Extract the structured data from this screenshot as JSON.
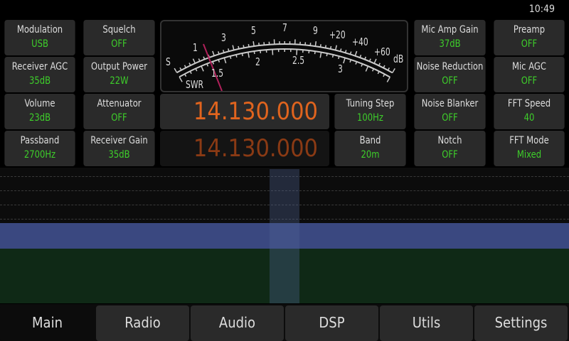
{
  "status": {
    "time": "10:49"
  },
  "controls": [
    {
      "label": "Modulation",
      "value": "USB"
    },
    {
      "label": "Squelch",
      "value": "OFF"
    },
    {
      "label": "Mic Amp Gain",
      "value": "37dB"
    },
    {
      "label": "Preamp",
      "value": "OFF"
    },
    {
      "label": "Receiver AGC",
      "value": "35dB"
    },
    {
      "label": "Output Power",
      "value": "22W"
    },
    {
      "label": "Noise Reduction",
      "value": "OFF"
    },
    {
      "label": "Mic AGC",
      "value": "OFF"
    },
    {
      "label": "Volume",
      "value": "23dB"
    },
    {
      "label": "Attenuator",
      "value": "OFF"
    },
    {
      "label": "Tuning Step",
      "value": "100Hz"
    },
    {
      "label": "Noise Blanker",
      "value": "OFF"
    },
    {
      "label": "FFT Speed",
      "value": "40"
    },
    {
      "label": "Passband",
      "value": "2700Hz"
    },
    {
      "label": "Receiver Gain",
      "value": "35dB"
    },
    {
      "label": "Band",
      "value": "20m"
    },
    {
      "label": "Notch",
      "value": "OFF"
    },
    {
      "label": "FFT Mode",
      "value": "Mixed"
    }
  ],
  "meter": {
    "s_labels": [
      "S",
      "1",
      "3",
      "5",
      "7",
      "9",
      "+20",
      "+40",
      "+60",
      "dB"
    ],
    "swr_labels": [
      "SWR",
      "1.5",
      "2",
      "2.5",
      "3"
    ],
    "needle_color": "#b0205a"
  },
  "frequency": {
    "vfo_a": "14.130.000",
    "vfo_b": "14.130.000",
    "active_color": "#e0641e",
    "inactive_color": "#8a3a14"
  },
  "tabs": [
    {
      "label": "Main",
      "active": true
    },
    {
      "label": "Radio"
    },
    {
      "label": "Audio"
    },
    {
      "label": "DSP"
    },
    {
      "label": "Utils"
    },
    {
      "label": "Settings"
    }
  ]
}
